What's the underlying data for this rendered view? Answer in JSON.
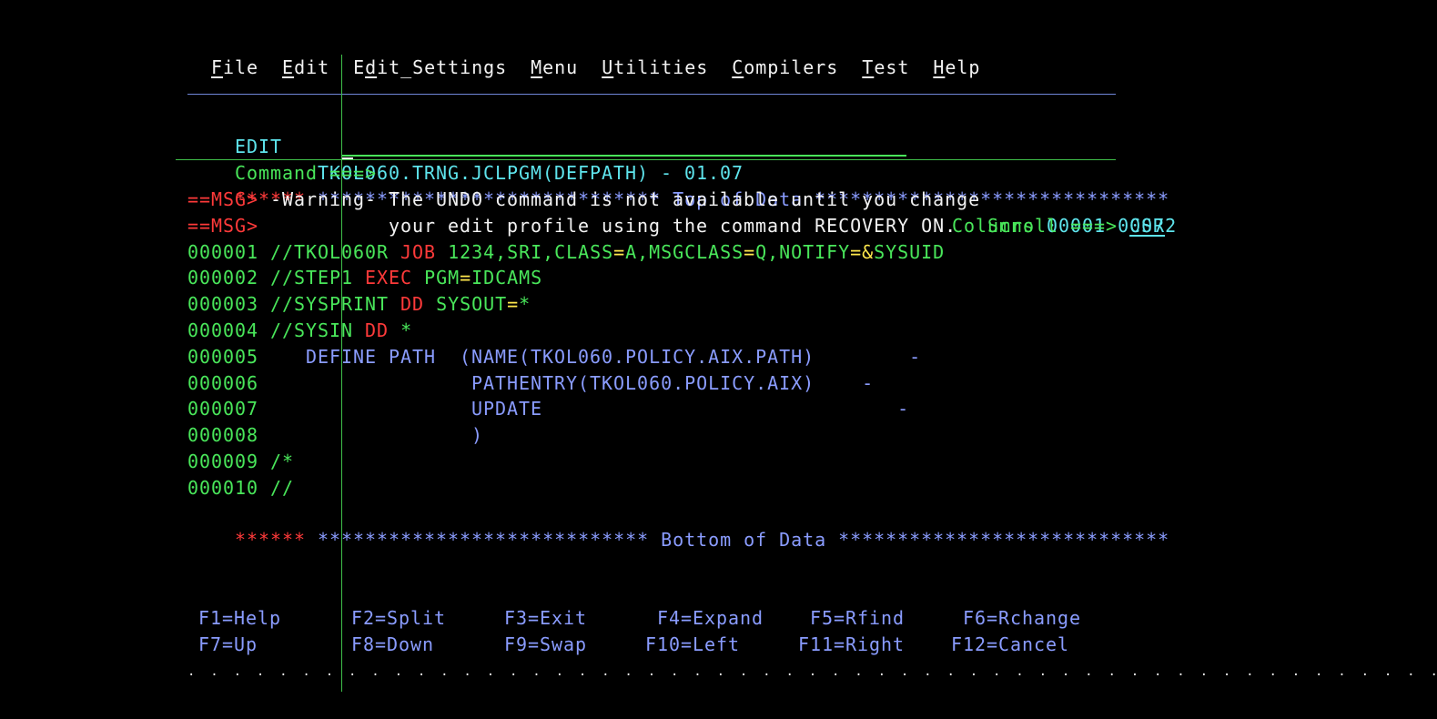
{
  "menu": {
    "items": [
      {
        "hot": "F",
        "rest": "ile"
      },
      {
        "hot": "E",
        "rest": "dit"
      },
      {
        "pre": "E",
        "hot": "d",
        "rest": "it_Settings"
      },
      {
        "hot": "M",
        "rest": "enu"
      },
      {
        "hot": "U",
        "rest": "tilities"
      },
      {
        "hot": "C",
        "rest": "ompilers"
      },
      {
        "hot": "T",
        "rest": "est"
      },
      {
        "hot": "H",
        "rest": "elp"
      }
    ]
  },
  "header": {
    "mode": "EDIT",
    "dataset": "TKOL060.TRNG.JCLPGM(DEFPATH) - 01.07",
    "columns_label": "Columns",
    "col_from": "00001",
    "col_to": "00072",
    "command_label": "Command ===>",
    "command_value": "",
    "scroll_label": "Scroll ===>",
    "scroll_value": "CSR"
  },
  "top_marker": {
    "prefix": "******",
    "text": "***************************** Top of Data ******************************"
  },
  "messages": [
    {
      "prefix": "==MSG>",
      "text": "-Warning- The UNDO command is not available until you change"
    },
    {
      "prefix": "==MSG>",
      "text": "          your edit profile using the command RECOVERY ON."
    }
  ],
  "lines": [
    {
      "num": "000001",
      "parts": [
        {
          "t": "//TKOL060R ",
          "c": "green"
        },
        {
          "t": "JOB ",
          "c": "red"
        },
        {
          "t": "1234,SRI,CLASS",
          "c": "green"
        },
        {
          "t": "=",
          "c": "yellow"
        },
        {
          "t": "A,MSGCLASS",
          "c": "green"
        },
        {
          "t": "=",
          "c": "yellow"
        },
        {
          "t": "Q,NOTIFY",
          "c": "green"
        },
        {
          "t": "=&",
          "c": "yellow"
        },
        {
          "t": "SYSUID",
          "c": "green"
        }
      ]
    },
    {
      "num": "000002",
      "parts": [
        {
          "t": "//STEP1 ",
          "c": "green"
        },
        {
          "t": "EXEC ",
          "c": "red"
        },
        {
          "t": "PGM",
          "c": "green"
        },
        {
          "t": "=",
          "c": "yellow"
        },
        {
          "t": "IDCAMS",
          "c": "green"
        }
      ]
    },
    {
      "num": "000003",
      "parts": [
        {
          "t": "//SYSPRINT ",
          "c": "green"
        },
        {
          "t": "DD ",
          "c": "red"
        },
        {
          "t": "SYSOUT",
          "c": "green"
        },
        {
          "t": "=",
          "c": "yellow"
        },
        {
          "t": "*",
          "c": "green"
        }
      ]
    },
    {
      "num": "000004",
      "parts": [
        {
          "t": "//SYSIN ",
          "c": "green"
        },
        {
          "t": "DD ",
          "c": "red"
        },
        {
          "t": "*",
          "c": "green"
        }
      ]
    },
    {
      "num": "000005",
      "parts": [
        {
          "t": "   DEFINE PATH  (NAME(TKOL060.POLICY.AIX.PATH)        -",
          "c": "blue"
        }
      ]
    },
    {
      "num": "000006",
      "parts": [
        {
          "t": "                 PATHENTRY(TKOL060.POLICY.AIX)    -",
          "c": "blue"
        }
      ]
    },
    {
      "num": "000007",
      "parts": [
        {
          "t": "                 UPDATE                              -",
          "c": "blue"
        }
      ]
    },
    {
      "num": "000008",
      "parts": [
        {
          "t": "                 )",
          "c": "blue"
        }
      ]
    },
    {
      "num": "000009",
      "parts": [
        {
          "t": "/*",
          "c": "green"
        }
      ]
    },
    {
      "num": "000010",
      "parts": [
        {
          "t": "//",
          "c": "green"
        }
      ]
    }
  ],
  "bottom_marker": {
    "prefix": "******",
    "text": "**************************** Bottom of Data ****************************"
  },
  "fkeys_row1": [
    "F1=Help",
    "F2=Split",
    "F3=Exit",
    "F4=Expand",
    "F5=Rfind",
    "F6=Rchange"
  ],
  "fkeys_row2": [
    "F7=Up",
    "F8=Down",
    "F9=Swap",
    "F10=Left",
    "F11=Right",
    "F12=Cancel"
  ],
  "dots": ".  .  .  .  .  .  .  .  .  .  .  .  .  .  .  .  .  .  .  .  .  .  .  .  .  .  .  .  .  .  .  .  .  .  .  .  .  .  .  .  .  .  .  .  .  .  .  .  .  .  .  .  .  .  .  .  ."
}
